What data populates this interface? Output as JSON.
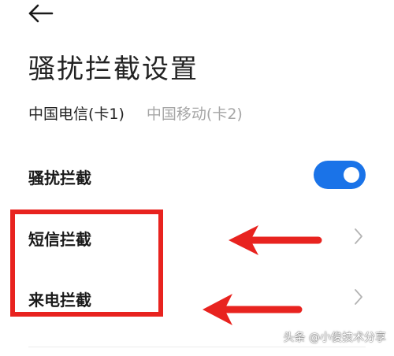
{
  "header": {
    "back_icon": "arrow-left-icon",
    "title": "骚扰拦截设置"
  },
  "sim_tabs": [
    {
      "label": "中国电信(卡1)",
      "active": true
    },
    {
      "label": "中国移动(卡2)",
      "active": false
    }
  ],
  "settings": {
    "block": {
      "label": "骚扰拦截",
      "enabled": true
    },
    "sms": {
      "label": "短信拦截",
      "icon": "chevron-right-icon"
    },
    "call": {
      "label": "来电拦截",
      "icon": "chevron-right-icon"
    }
  },
  "annotation": {
    "highlight_color": "#e8231f",
    "arrow_color": "#e8231f"
  },
  "colors": {
    "accent": "#1a73e8",
    "text": "#1a1a1a",
    "inactive_text": "#a6a6a6"
  },
  "watermark": "头条 @小俊技术分享"
}
